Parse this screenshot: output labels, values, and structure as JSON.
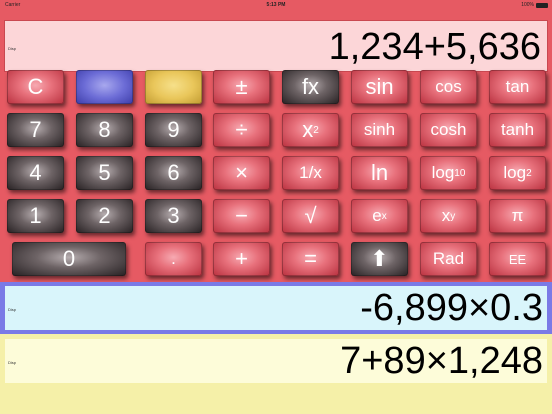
{
  "status_bar": {
    "carrier": "Carrier",
    "time": "5:13 PM",
    "battery": "100%"
  },
  "display": {
    "main": "1,234+5,636",
    "memory_1": "-6,899×0.3",
    "memory_2": "7+89×1,248",
    "tag": "Disp"
  },
  "buttons": {
    "clear": "C",
    "plus_minus": "±",
    "fx": "fx",
    "sin": "sin",
    "cos": "cos",
    "tan": "tan",
    "seven": "7",
    "eight": "8",
    "nine": "9",
    "divide": "÷",
    "square_base": "x",
    "square_exp": "2",
    "sinh": "sinh",
    "cosh": "cosh",
    "tanh": "tanh",
    "four": "4",
    "five": "5",
    "six": "6",
    "multiply": "×",
    "reciprocal": "1/x",
    "ln": "ln",
    "log10_base": "log",
    "log10_sub": "10",
    "log2_base": "log",
    "log2_sub": "2",
    "one": "1",
    "two": "2",
    "three": "3",
    "minus": "−",
    "sqrt": "√",
    "exp_base": "e",
    "exp_exp": "x",
    "pow_base": "x",
    "pow_exp": "y",
    "pi": "π",
    "zero": "0",
    "decimal": ".",
    "plus": "+",
    "equals": "=",
    "shift": "⬆",
    "rad": "Rad",
    "ee": "EE"
  },
  "colors": {
    "body": "#e65a63",
    "main_display": "#fcd6d8",
    "memory_1_border": "#7a7ae6",
    "memory_1_bg": "#d9f5fb",
    "memory_2_bg": "#fdfcd9",
    "memory_2_outer": "#f5f0a8"
  }
}
